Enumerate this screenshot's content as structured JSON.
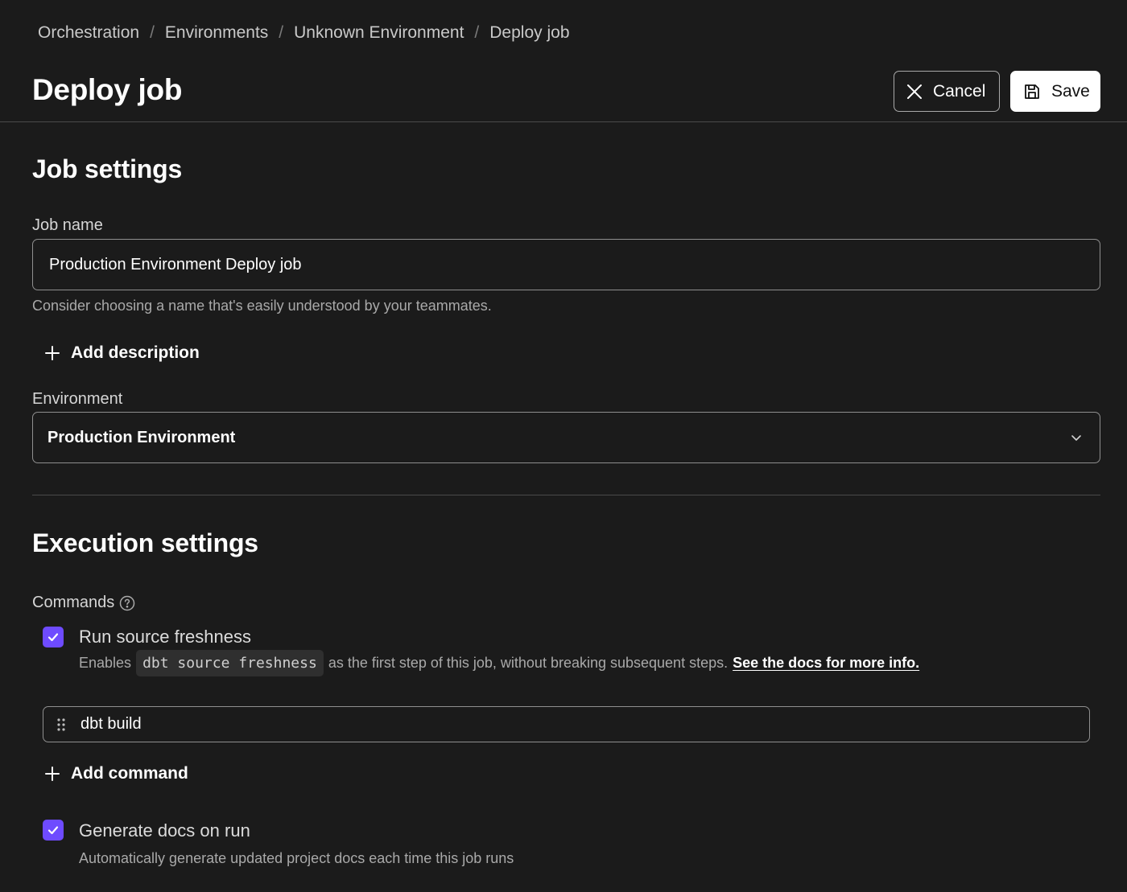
{
  "breadcrumb": {
    "items": [
      "Orchestration",
      "Environments",
      "Unknown Environment",
      "Deploy job"
    ],
    "separator": "/"
  },
  "header": {
    "title": "Deploy job",
    "cancel_label": "Cancel",
    "save_label": "Save"
  },
  "job_settings": {
    "title": "Job settings",
    "job_name_label": "Job name",
    "job_name_value": "Production Environment Deploy job",
    "job_name_hint": "Consider choosing a name that's easily understood by your teammates.",
    "add_description_label": "Add description",
    "environment_label": "Environment",
    "environment_value": "Production Environment"
  },
  "execution_settings": {
    "title": "Execution settings",
    "commands_label": "Commands",
    "run_source_freshness": {
      "checked": true,
      "title": "Run source freshness",
      "desc_prefix": "Enables",
      "desc_code": "dbt source freshness",
      "desc_suffix": "as the first step of this job, without breaking subsequent steps.",
      "docs_link": "See the docs for more info."
    },
    "commands": [
      "dbt build"
    ],
    "add_command_label": "Add command",
    "generate_docs": {
      "checked": true,
      "title": "Generate docs on run",
      "desc": "Automatically generate updated project docs each time this job runs"
    }
  },
  "colors": {
    "background": "#1b1b1b",
    "accent_checkbox": "#6e4bff",
    "border": "#8f8f8f",
    "divider": "#4a4a4a"
  },
  "icons": [
    "close-icon",
    "save-icon",
    "plus-icon",
    "chevron-down-icon",
    "help-circle-icon",
    "check-icon",
    "drag-handle-icon"
  ]
}
